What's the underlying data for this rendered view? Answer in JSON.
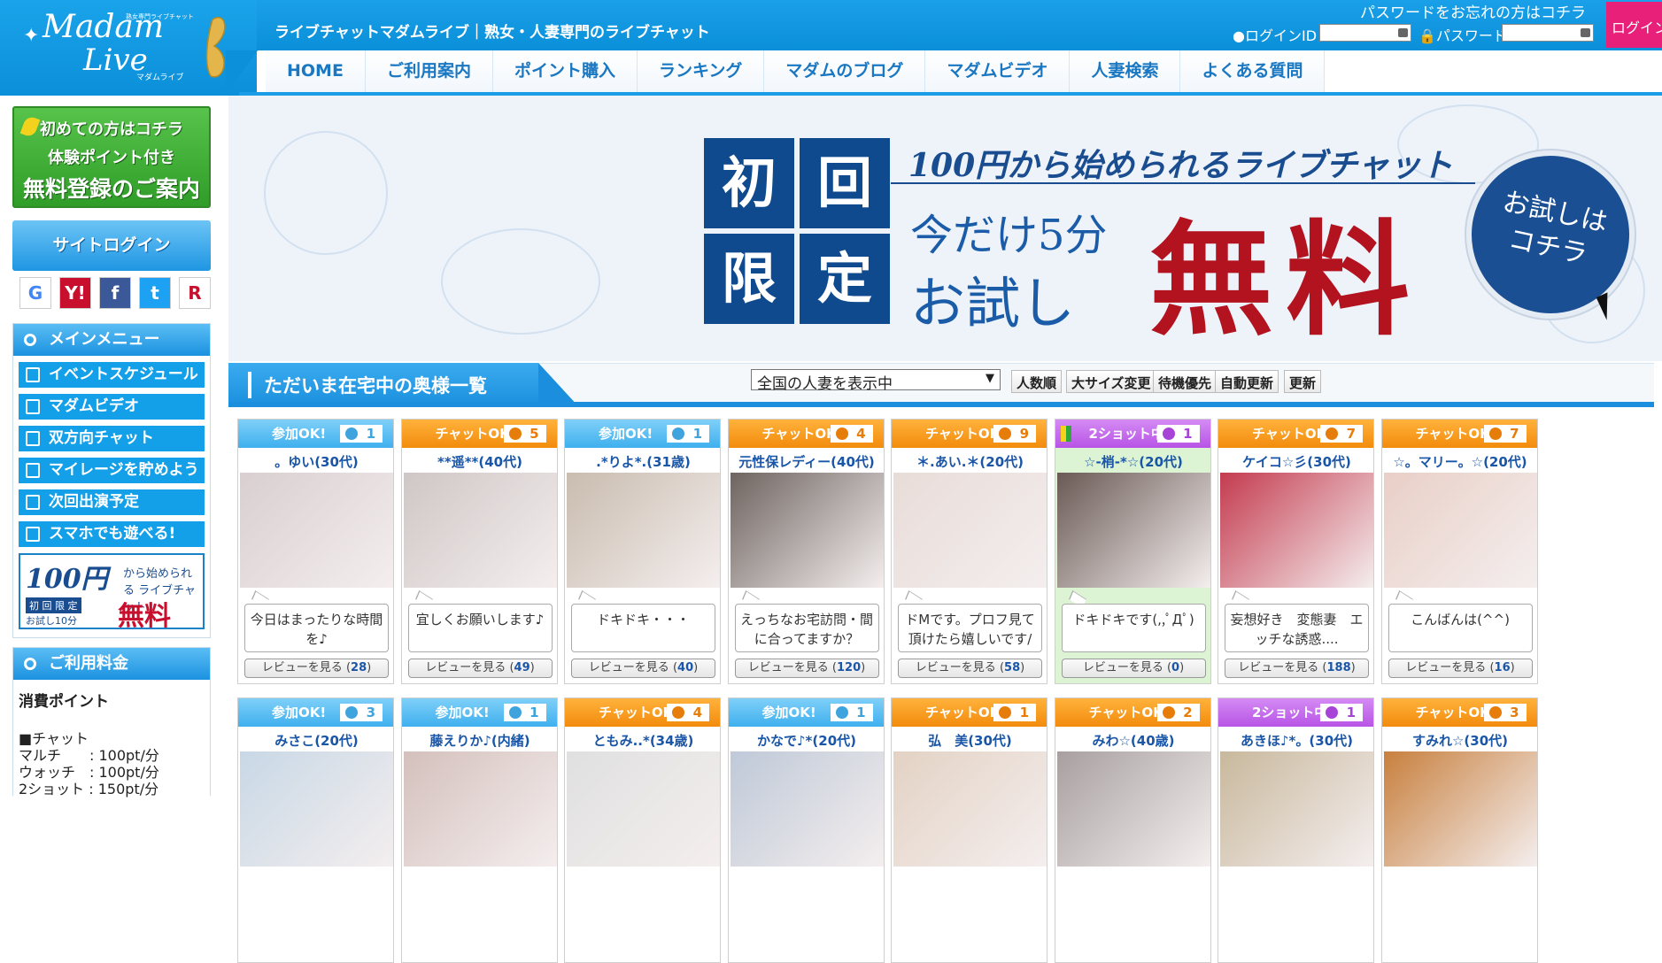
{
  "header": {
    "logo_main": "Madam",
    "logo_main2": "Live",
    "logo_sub": "マダムライブ",
    "logo_sub2": "熟女専門ライブチャット",
    "tagline": "ライブチャットマダムライブ｜熟女・人妻専門のライブチャット",
    "forgot_password": "パスワードをお忘れの方はコチラ",
    "login_id_label": "ログインID",
    "password_label": "パスワード",
    "login_button": "ログイン"
  },
  "nav": [
    "HOME",
    "ご利用案内",
    "ポイント購入",
    "ランキング",
    "マダムのブログ",
    "マダムビデオ",
    "人妻検索",
    "よくある質問"
  ],
  "sidebar": {
    "first_time": {
      "line1": "初めての方はコチラ",
      "line2": "体験ポイント付き",
      "line3": "無料登録のご案内"
    },
    "site_login": "サイトログイン",
    "social": [
      "G",
      "Y!",
      "f",
      "t",
      "R"
    ],
    "main_menu_title": "メインメニュー",
    "menu_items": [
      "イベントスケジュール",
      "マダムビデオ",
      "双方向チャット",
      "マイレージを貯めよう",
      "次回出演予定",
      "スマホでも遊べる!"
    ],
    "promo": {
      "p1": "100円",
      "p2": "から始められる ライブチャット",
      "p3": "初 回 限 定",
      "p4": "お試し10分",
      "p5": "無料"
    },
    "fee_title": "ご利用料金",
    "fee_subtitle": "消費ポイント",
    "fee_lines": [
      "■チャット",
      "マルチ　　: 100pt/分",
      "ウォッチ　: 100pt/分",
      "2ショット : 150pt/分"
    ]
  },
  "banner": {
    "tiles": [
      "初",
      "回",
      "限",
      "定"
    ],
    "line1": "100円から始められるライブチャット",
    "line2": "今だけ5分",
    "line3": "お試し",
    "free": "無料",
    "trial_line1": "お試しは",
    "trial_line2": "コチラ"
  },
  "online": {
    "title": "ただいま在宅中の奥様一覧",
    "region_select": "全国の人妻を表示中",
    "tools": [
      "人数順",
      "大サイズ変更",
      "待機優先",
      "自動更新",
      "更新"
    ]
  },
  "review_label": "レビューを見る",
  "cards": [
    {
      "badge": "参加OK!",
      "type": "join",
      "count": "1",
      "name": "。ゆい",
      "age": "(30代)",
      "comment": "今日はまったりな時間を♪",
      "reviews": "28"
    },
    {
      "badge": "チャットOK!",
      "type": "chat",
      "count": "5",
      "name": "**遥**",
      "age": "(40代)",
      "comment": "宜しくお願いします♪",
      "reviews": "49"
    },
    {
      "badge": "参加OK!",
      "type": "join",
      "count": "1",
      "name": ".*りよ*.",
      "age": "(31歳)",
      "comment": "ドキドキ・・・",
      "reviews": "40"
    },
    {
      "badge": "チャットOK!",
      "type": "chat",
      "count": "4",
      "name": "元性保レディー",
      "age": "(40代)",
      "comment": "えっちなお宅訪問・間に合ってますか？",
      "reviews": "120"
    },
    {
      "badge": "チャットOK!",
      "type": "chat",
      "count": "9",
      "name": "＊.あい.＊",
      "age": "(20代)",
      "comment": "ドMです。プロフ見て頂けたら嬉しいです/",
      "reviews": "58"
    },
    {
      "badge": "2ショット中",
      "type": "2shot",
      "count": "1",
      "name": "☆-梢-*☆",
      "age": "(20代)",
      "comment": "ドキドキです(,,ﾟДﾟ)",
      "reviews": "0"
    },
    {
      "badge": "チャットOK!",
      "type": "chat",
      "count": "7",
      "name": "ケイコ☆彡",
      "age": "(30代)",
      "comment": "妄想好き　変態妻　エッチな誘惑....",
      "reviews": "188"
    },
    {
      "badge": "チャットOK!",
      "type": "chat",
      "count": "7",
      "name": "☆。マリー。☆",
      "age": "(20代)",
      "comment": "こんばんは(^^)",
      "reviews": "16"
    },
    {
      "badge": "参加OK!",
      "type": "join",
      "count": "3",
      "name": "みさこ",
      "age": "(20代)"
    },
    {
      "badge": "参加OK!",
      "type": "join",
      "count": "1",
      "name": "藤えりか♪",
      "age": "(内緒)"
    },
    {
      "badge": "チャットOK!",
      "type": "chat",
      "count": "4",
      "name": "ともみ..*",
      "age": "(34歳)"
    },
    {
      "badge": "参加OK!",
      "type": "join",
      "count": "1",
      "name": "かなで♪*",
      "age": "(20代)"
    },
    {
      "badge": "チャットOK!",
      "type": "chat",
      "count": "1",
      "name": "弘　美",
      "age": "(30代)"
    },
    {
      "badge": "チャットOK!",
      "type": "chat",
      "count": "2",
      "name": "みわ☆",
      "age": "(40歳)"
    },
    {
      "badge": "2ショット中",
      "type": "2shot",
      "count": "1",
      "name": "あきほ♪*。",
      "age": "(30代)"
    },
    {
      "badge": "チャットOK!",
      "type": "chat",
      "count": "3",
      "name": "すみれ☆",
      "age": "(30代)"
    }
  ]
}
